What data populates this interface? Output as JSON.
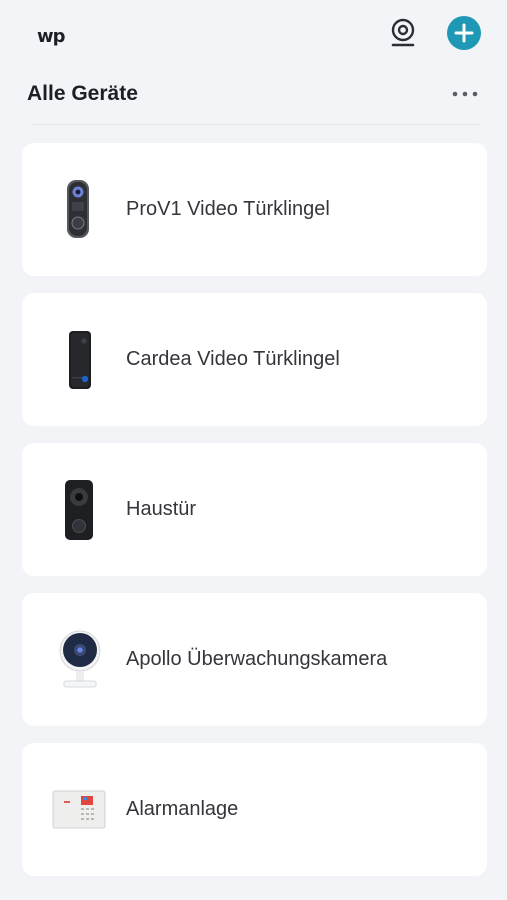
{
  "app": {
    "logo_text": "wp"
  },
  "header": {
    "title": "Alle Geräte",
    "camera_icon": "camera-icon",
    "add_icon": "plus-icon",
    "more_icon": "more-dots-icon",
    "accent_color": "#1e98b5"
  },
  "devices": [
    {
      "name": "ProV1 Video Türklingel",
      "icon": "doorbell-prov1-image"
    },
    {
      "name": "Cardea Video Türklingel",
      "icon": "doorbell-cardea-image"
    },
    {
      "name": "Haustür",
      "icon": "doorbell-black-image"
    },
    {
      "name": "Apollo Überwachungskamera",
      "icon": "indoor-camera-image"
    },
    {
      "name": "Alarmanlage",
      "icon": "alarm-panel-image"
    }
  ]
}
